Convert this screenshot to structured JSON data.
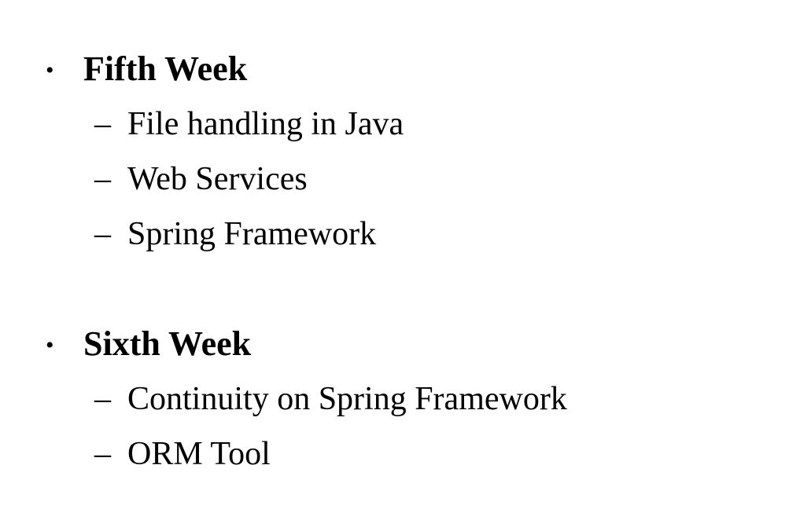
{
  "slide": {
    "sections": [
      {
        "bullet": "•",
        "heading": "Fifth Week",
        "items": [
          {
            "dash": "–",
            "text": "File handling in Java"
          },
          {
            "dash": "–",
            "text": "Web Services"
          },
          {
            "dash": "–",
            "text": "Spring Framework"
          }
        ]
      },
      {
        "bullet": "•",
        "heading": "Sixth Week",
        "items": [
          {
            "dash": "–",
            "text": "Continuity on Spring Framework"
          },
          {
            "dash": "–",
            "text": "ORM Tool"
          }
        ]
      }
    ]
  }
}
